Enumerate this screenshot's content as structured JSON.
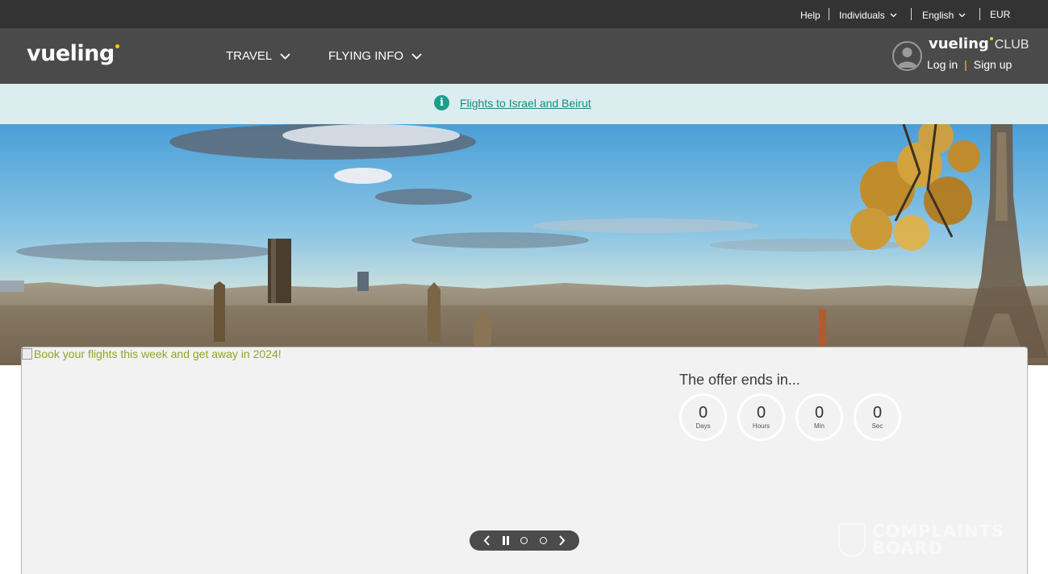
{
  "topbar": {
    "help": "Help",
    "audience": "Individuals",
    "language": "English",
    "currency": "EUR"
  },
  "header": {
    "logo": "vueling",
    "nav": [
      {
        "label": "TRAVEL"
      },
      {
        "label": "FLYING INFO"
      }
    ],
    "club": {
      "logo": "vueling",
      "suffix": "CLUB",
      "login": "Log in",
      "signup": "Sign up"
    }
  },
  "notice": {
    "icon": "info-icon",
    "link_text": "Flights to Israel and Beirut"
  },
  "hero": {
    "image_description": "Paris skyline with Eiffel Tower"
  },
  "promo": {
    "image_alt": "Book your flights this week and get away in 2024!",
    "offer_title": "The offer ends in...",
    "countdown": [
      {
        "value": "0",
        "unit": "Days"
      },
      {
        "value": "0",
        "unit": "Hours"
      },
      {
        "value": "0",
        "unit": "Min"
      },
      {
        "value": "0",
        "unit": "Sec"
      }
    ]
  },
  "watermark": {
    "text_line1": "COMPLAINTS",
    "text_line2": "BOARD"
  },
  "colors": {
    "topbar_bg": "#333333",
    "nav_bg": "#4a4a4a",
    "brand_yellow": "#ffcc00",
    "notice_bg": "#dcedf0",
    "notice_link": "#168d7e",
    "card_bg": "#f2f2f2"
  }
}
